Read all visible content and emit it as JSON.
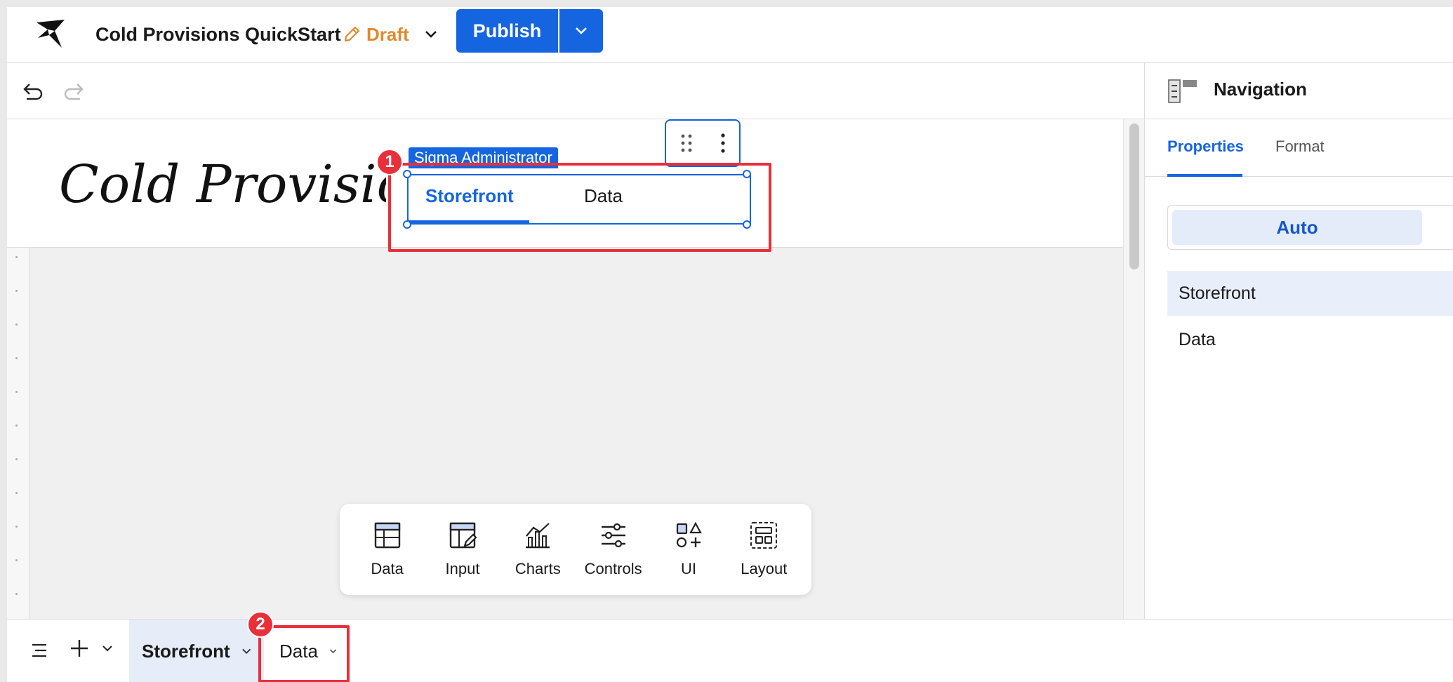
{
  "header": {
    "title": "Cold Provisions QuickStart",
    "status": "Draft",
    "publish_label": "Publish"
  },
  "canvas": {
    "logo_text": "Cold Provisions",
    "role_badge": "Sigma Administrator",
    "tabs": [
      {
        "label": "Storefront",
        "selected": true
      },
      {
        "label": "Data",
        "selected": false
      }
    ],
    "annotations": [
      "1",
      "2"
    ]
  },
  "insert_bar": {
    "items": [
      "Data",
      "Input",
      "Charts",
      "Controls",
      "UI",
      "Layout"
    ]
  },
  "right_panel": {
    "title": "Navigation",
    "tabs": [
      "Properties",
      "Format"
    ],
    "auto_label": "Auto",
    "nav_items": [
      "Storefront",
      "Data"
    ]
  },
  "bottom_bar": {
    "pages": [
      "Storefront",
      "Data"
    ]
  },
  "colors": {
    "accent": "#1565e0",
    "draft": "#e08a2c",
    "annotation": "#e8303b"
  }
}
